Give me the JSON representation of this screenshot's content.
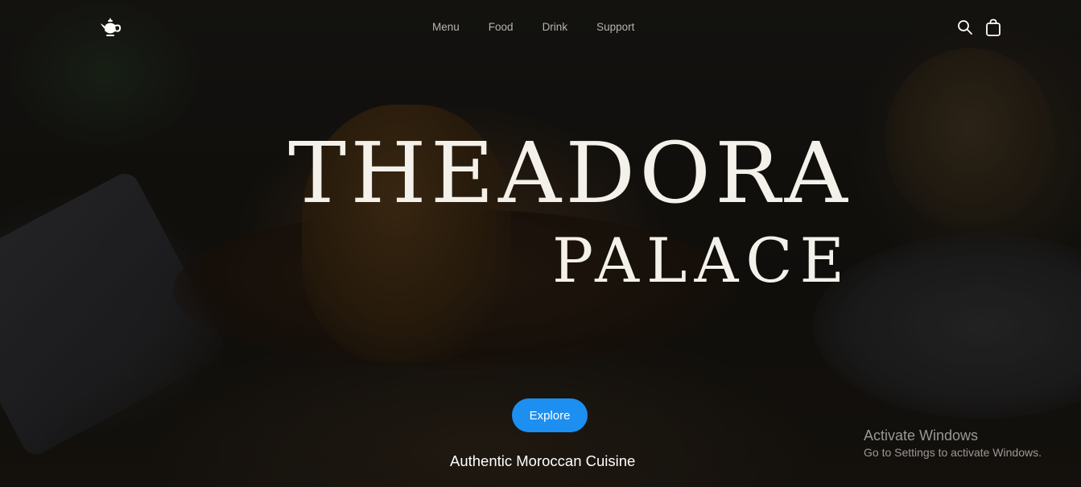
{
  "nav": {
    "logo_icon": "teapot-icon",
    "links": [
      "Menu",
      "Food",
      "Drink",
      "Support"
    ],
    "icons": [
      "search-icon",
      "shopping-bag-icon"
    ]
  },
  "hero": {
    "title": "THEADORA",
    "subtitle": "PALACE",
    "explore_label": "Explore",
    "tagline": "Authentic Moroccan Cuisine"
  },
  "watermark": {
    "title": "Activate Windows",
    "subtitle": "Go to Settings to activate Windows."
  },
  "colors": {
    "accent": "#1c8ff1",
    "title_text": "#f4f1ea",
    "nav_text": "#b8b4ae"
  }
}
